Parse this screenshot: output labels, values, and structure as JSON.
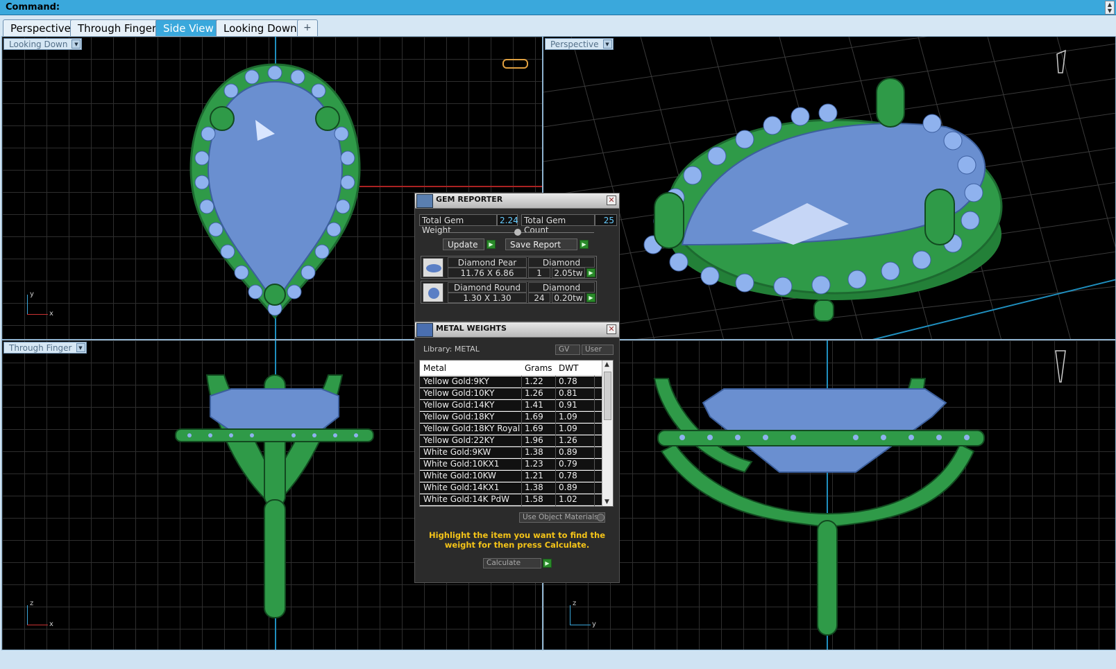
{
  "command": {
    "label": "Command:"
  },
  "tabs": [
    {
      "label": "Perspective",
      "active": false
    },
    {
      "label": "Through Finger",
      "active": false
    },
    {
      "label": "Side View",
      "active": true
    },
    {
      "label": "Looking Down",
      "active": false
    },
    {
      "label": "+",
      "active": false
    }
  ],
  "viewports": {
    "top_left": {
      "label": "Looking Down",
      "axis_x": "x",
      "axis_y": "y"
    },
    "top_right": {
      "label": "Perspective"
    },
    "bottom_left": {
      "label": "Through Finger",
      "axis_x": "x",
      "axis_y": "z"
    },
    "bottom_right": {
      "label": "",
      "axis_x": "y",
      "axis_y": "z"
    }
  },
  "gem_reporter": {
    "title": "GEM REPORTER",
    "total_weight_label": "Total Gem Weight",
    "total_weight_value": "2.24",
    "total_count_label": "Total Gem Count",
    "total_count_value": "25",
    "update_label": "Update",
    "save_label": "Save Report",
    "gems": [
      {
        "name": "Diamond Pear",
        "material": "Diamond",
        "size": "11.76 X 6.86",
        "count": "1",
        "weight": "2.05tw"
      },
      {
        "name": "Diamond Round",
        "material": "Diamond",
        "size": "1.30 X 1.30",
        "count": "24",
        "weight": "0.20tw"
      }
    ]
  },
  "metal_weights": {
    "title": "METAL WEIGHTS",
    "library_label": "Library: METAL",
    "gv_label": "GV",
    "user_label": "User",
    "columns": [
      "Metal",
      "Grams",
      "DWT"
    ],
    "rows": [
      {
        "metal": "Yellow Gold:9KY",
        "grams": "1.22",
        "dwt": "0.78"
      },
      {
        "metal": "Yellow Gold:10KY",
        "grams": "1.26",
        "dwt": "0.81"
      },
      {
        "metal": "Yellow Gold:14KY",
        "grams": "1.41",
        "dwt": "0.91"
      },
      {
        "metal": "Yellow Gold:18KY",
        "grams": "1.69",
        "dwt": "1.09"
      },
      {
        "metal": "Yellow Gold:18KY Royal",
        "grams": "1.69",
        "dwt": "1.09"
      },
      {
        "metal": "Yellow Gold:22KY",
        "grams": "1.96",
        "dwt": "1.26"
      },
      {
        "metal": "White Gold:9KW",
        "grams": "1.38",
        "dwt": "0.89"
      },
      {
        "metal": "White Gold:10KX1",
        "grams": "1.23",
        "dwt": "0.79"
      },
      {
        "metal": "White Gold:10KW",
        "grams": "1.21",
        "dwt": "0.78"
      },
      {
        "metal": "White Gold:14KX1",
        "grams": "1.38",
        "dwt": "0.89"
      },
      {
        "metal": "White Gold:14K PdW",
        "grams": "1.58",
        "dwt": "1.02"
      }
    ],
    "use_object_materials": "Use Object Materials",
    "hint": "Highlight the item you want to find the weight for then press Calculate.",
    "calculate_label": "Calculate"
  },
  "colors": {
    "accent": "#3aa8dc",
    "metal_green": "#2e8b45",
    "gem_blue": "#6a8fd0",
    "hint_yellow": "#f5c418"
  }
}
